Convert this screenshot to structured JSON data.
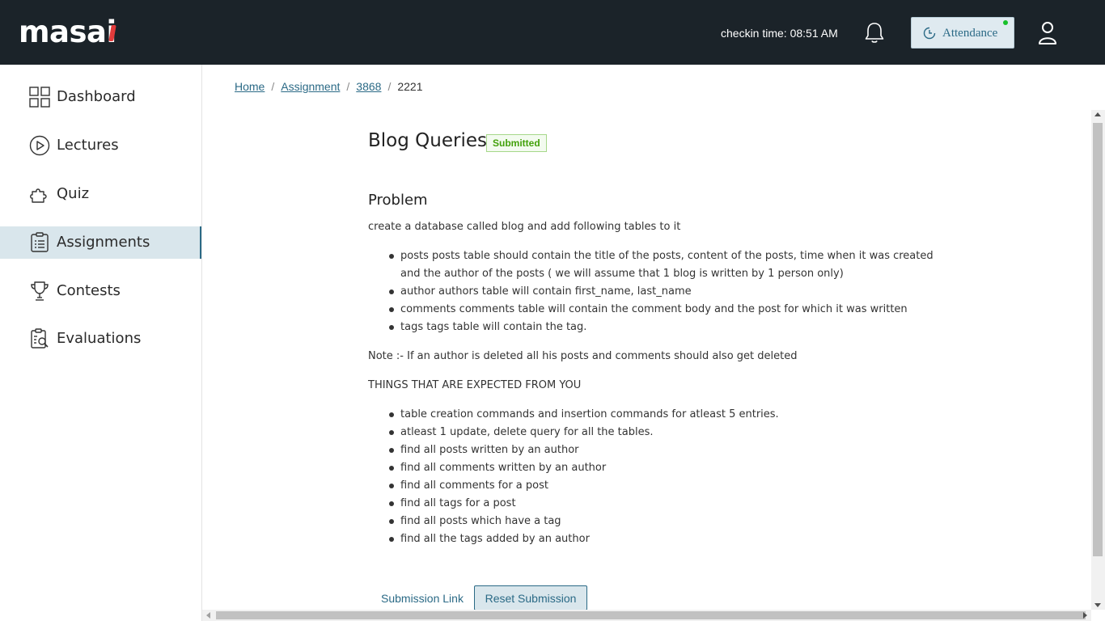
{
  "header": {
    "logo": "masai",
    "checkin": "checkin time: 08:51 AM",
    "attendance_label": "Attendance",
    "icons": {
      "bell": "bell-icon",
      "user": "user-icon",
      "attendance": "clock-icon"
    },
    "colors": {
      "bg": "#1b2329",
      "brand_dot": "#e23b3b",
      "status_dot": "#17c12a"
    }
  },
  "sidebar": {
    "items": [
      {
        "label": "Dashboard",
        "icon": "dashboard-icon"
      },
      {
        "label": "Lectures",
        "icon": "play-icon"
      },
      {
        "label": "Quiz",
        "icon": "puzzle-icon"
      },
      {
        "label": "Assignments",
        "icon": "clipboard-icon",
        "active": true
      },
      {
        "label": "Contests",
        "icon": "trophy-icon"
      },
      {
        "label": "Evaluations",
        "icon": "report-icon"
      }
    ]
  },
  "breadcrumb": [
    "Home",
    "Assignment",
    "3868",
    "2221"
  ],
  "assignment": {
    "title": "Blog Queries",
    "status": "Submitted",
    "section_heading": "Problem",
    "intro": "create a database called blog and add following tables to it",
    "tables": [
      "posts posts table should contain the title of the posts, content of the posts, time when it was created and the author of the posts ( we will assume that 1 blog is written by 1 person only)",
      "author authors table will contain first_name, last_name",
      "comments comments table will contain the comment body and the post for which it was written",
      "tags tags table will contain the tag."
    ],
    "note": "Note :- If an author is deleted all his posts and comments should also get deleted",
    "expected_heading": "THINGS THAT ARE EXPECTED FROM YOU",
    "expected": [
      "table creation commands and insertion commands for atleast 5 entries.",
      "atleast 1 update, delete query for all the tables.",
      "find all posts written by an author",
      "find all comments written by an author",
      "find all comments for a post",
      "find all tags for a post",
      "find all posts which have a tag",
      "find all the tags added by an author"
    ]
  },
  "actions": {
    "submission_link": "Submission Link",
    "reset_submission": "Reset Submission"
  },
  "colors": {
    "accent": "#2b6a86",
    "active_bg": "#d9e6ec",
    "badge_green": "#43a10b"
  }
}
